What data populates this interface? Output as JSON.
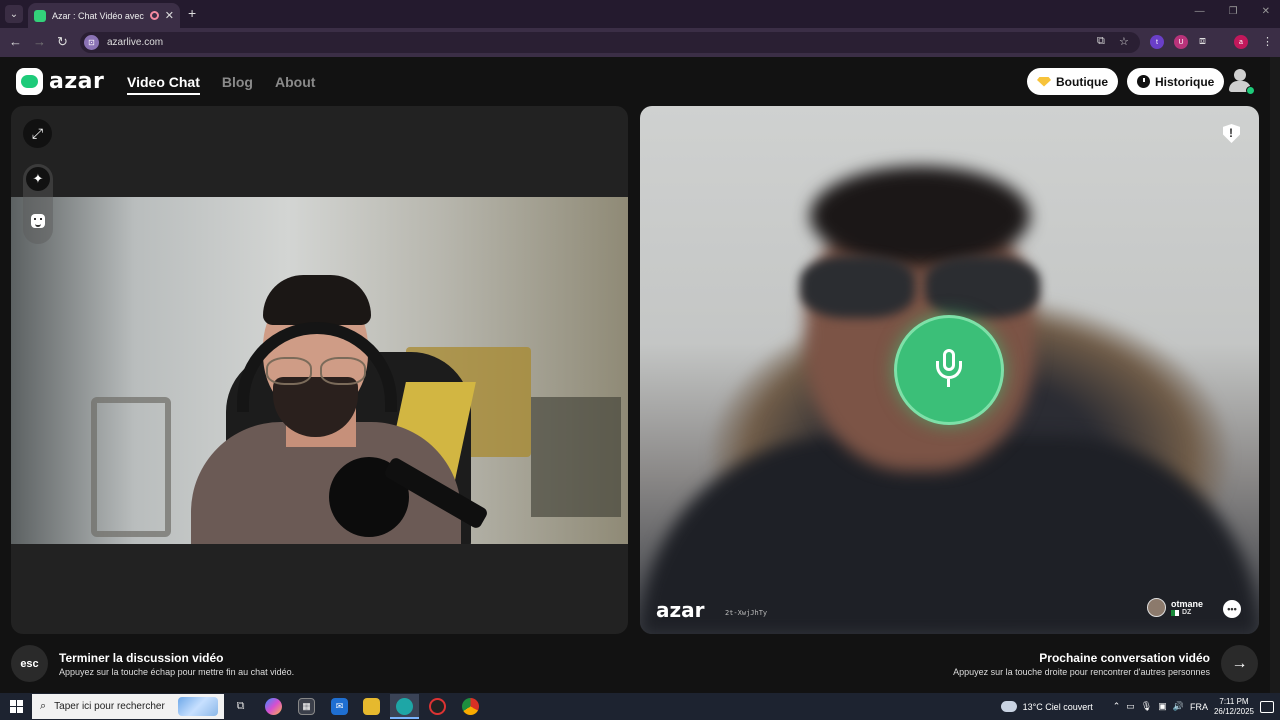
{
  "browser": {
    "tab_title": "Azar : Chat Vidéo avec de n",
    "new_tab_icon": "plus-icon",
    "url": "azarlive.com",
    "extensions": [
      {
        "letter": "t",
        "color": "#6a3fc8"
      },
      {
        "letter": "U",
        "color": "#b8337a"
      },
      {
        "letter": "a",
        "color": "#c2185b"
      }
    ]
  },
  "header": {
    "logo_text": "azar",
    "nav": [
      {
        "label": "Video Chat",
        "active": true
      },
      {
        "label": "Blog",
        "active": false
      },
      {
        "label": "About",
        "active": false
      }
    ],
    "shop_label": "Boutique",
    "history_label": "Historique"
  },
  "partner": {
    "watermark": "azar",
    "watermark_id": "2t-XwjJhTy",
    "name": "otmane",
    "country": "DZ"
  },
  "footer": {
    "esc_key": "esc",
    "end_title": "Terminer la discussion vidéo",
    "end_sub": "Appuyez sur la touche échap pour mettre fin au chat vidéo.",
    "next_title": "Prochaine conversation vidéo",
    "next_sub": "Appuyez sur la touche droite pour rencontrer d'autres personnes"
  },
  "taskbar": {
    "search_placeholder": "Taper ici pour rechercher",
    "weather": "13°C  Ciel couvert",
    "language": "FRA",
    "time": "7:11 PM",
    "date": "26/12/2025"
  },
  "colors": {
    "accent_green": "#3bbf78",
    "brand_green": "#1ecb7a"
  }
}
